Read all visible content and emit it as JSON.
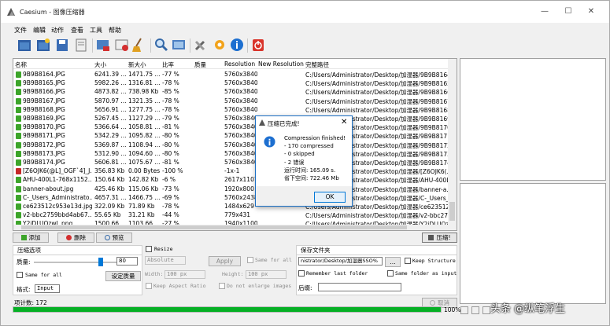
{
  "window": {
    "title": "Caesium - 图像压缩器"
  },
  "menu": [
    "文件",
    "编辑",
    "动作",
    "查看",
    "工具",
    "帮助"
  ],
  "toolbar_icons": [
    "open-folder-icon",
    "add-folder-icon",
    "save-icon",
    "document-icon",
    "remove-image-icon",
    "delete-all-icon",
    "clear-list-icon",
    "search-icon",
    "preview-icon",
    "settings-icon",
    "gear-icon",
    "info-icon",
    "exit-icon"
  ],
  "list": {
    "headers": [
      "名称",
      "大小",
      "新大小",
      "比率",
      "质量",
      "Resolution",
      "New Resolution",
      "完整路径"
    ],
    "rows": [
      {
        "name": "9B9B8164.JPG",
        "size": "6241.39 ...",
        "newsize": "1471.75 ...",
        "ratio": "-77 %",
        "res": "5760x3840",
        "path": "C:/Users/Administrator/Desktop/加湿器/9B9B8164...",
        "status": "ok"
      },
      {
        "name": "9B9B8165.JPG",
        "size": "5982.26 ...",
        "newsize": "1316.81 ...",
        "ratio": "-78 %",
        "res": "5760x3840",
        "path": "C:/Users/Administrator/Desktop/加湿器/9B9B8165...",
        "status": "ok"
      },
      {
        "name": "9B9B8166.JPG",
        "size": "4873.82 ...",
        "newsize": "738.98 Kb",
        "ratio": "-85 %",
        "res": "5760x3840",
        "path": "C:/Users/Administrator/Desktop/加湿器/9B9B8166...",
        "status": "ok"
      },
      {
        "name": "9B9B8167.JPG",
        "size": "5870.97 ...",
        "newsize": "1321.35 ...",
        "ratio": "-78 %",
        "res": "5760x3840",
        "path": "C:/Users/Administrator/Desktop/加湿器/9B9B8167...",
        "status": "ok"
      },
      {
        "name": "9B9B8168.JPG",
        "size": "5656.91 ...",
        "newsize": "1277.75 ...",
        "ratio": "-78 %",
        "res": "5760x3840",
        "path": "C:/Users/Administrator/Desktop/加湿器/9B9B8168...",
        "status": "ok"
      },
      {
        "name": "9B9B8169.JPG",
        "size": "5267.45 ...",
        "newsize": "1127.29 ...",
        "ratio": "-79 %",
        "res": "5760x3840",
        "path": "C:/Users/Administrator/Desktop/加湿器/9B9B8169...",
        "status": "ok"
      },
      {
        "name": "9B9B8170.JPG",
        "size": "5366.64 ...",
        "newsize": "1058.81 ...",
        "ratio": "-81 %",
        "res": "5760x3840",
        "path": "C:/Users/Administrator/Desktop/加湿器/9B9B8170...",
        "status": "ok"
      },
      {
        "name": "9B9B8171.JPG",
        "size": "5342.29 ...",
        "newsize": "1095.82 ...",
        "ratio": "-80 %",
        "res": "5760x3840",
        "path": "C:/Users/Administrator/Desktop/加湿器/9B9B8171...",
        "status": "ok"
      },
      {
        "name": "9B9B8172.JPG",
        "size": "5369.87 ...",
        "newsize": "1108.94 ...",
        "ratio": "-80 %",
        "res": "5760x3840",
        "path": "C:/Users/Administrator/Desktop/加湿器/9B9B8172...",
        "status": "ok"
      },
      {
        "name": "9B9B8173.JPG",
        "size": "5312.90 ...",
        "newsize": "1094.60 ...",
        "ratio": "-80 %",
        "res": "5760x3840",
        "path": "C:/Users/Administrator/Desktop/加湿器/9B9B8173...",
        "status": "ok"
      },
      {
        "name": "9B9B8174.JPG",
        "size": "5606.81 ...",
        "newsize": "1075.67 ...",
        "ratio": "-81 %",
        "res": "5760x3840",
        "path": "C:/Users/Administrator/Desktop/加湿器/9B9B8174...",
        "status": "ok"
      },
      {
        "name": "[Z6OJK6(@L]_OGF`4]_J...",
        "size": "356.83 Kb",
        "newsize": "0.00 Bytes",
        "ratio": "-100 %",
        "res": "-1x-1",
        "path": "C:/Users/Administrator/Desktop/加湿器/[Z6OJK6(...",
        "status": "error"
      },
      {
        "name": "AHU-400L1-768x1152....",
        "size": "150.64 Kb",
        "newsize": "142.82 Kb",
        "ratio": "-6 %",
        "res": "2617x1107",
        "path": "C:/Users/Administrator/Desktop/加湿器/AHU-400L...",
        "status": "ok"
      },
      {
        "name": "banner-about.jpg",
        "size": "425.46 Kb",
        "newsize": "115.06 Kb",
        "ratio": "-73 %",
        "res": "1920x800",
        "path": "C:/Users/Administrator/Desktop/加湿器/banner-a...",
        "status": "ok"
      },
      {
        "name": "C-_Users_Administrato...",
        "size": "4657.31 ...",
        "newsize": "1466.75 ...",
        "ratio": "-69 %",
        "res": "5760x2438",
        "path": "C:/Users/Administrator/Desktop/加湿器/C-_Users_...",
        "status": "ok"
      },
      {
        "name": "ce623512c953e13d.jpg",
        "size": "322.09 Kb",
        "newsize": "71.89 Kb",
        "ratio": "-78 %",
        "res": "1484x629",
        "path": "C:/Users/Administrator/Desktop/加湿器/ce623512...",
        "status": "ok"
      },
      {
        "name": "v2-bbc2759bbd4ab67...",
        "size": "55.65 Kb",
        "newsize": "31.21 Kb",
        "ratio": "-44 %",
        "res": "779x431",
        "path": "C:/Users/Administrator/Desktop/加湿器/v2-bbc27...",
        "status": "ok"
      },
      {
        "name": "Y2jDLUQzwL.png",
        "size": "1500.66 ...",
        "newsize": "1103.66 ...",
        "ratio": "-27 %",
        "res": "1940x1100",
        "path": "C:/Users/Administrator/Desktop/加湿器/Y2jDLUQz...",
        "status": "ok"
      }
    ]
  },
  "actions": {
    "add": "添加",
    "remove": "删除",
    "preview": "预览",
    "compress": "压缩!"
  },
  "compression": {
    "tab": "压缩选项",
    "quality_label": "质量:",
    "quality_value": "80",
    "quality_fraction": 0.8,
    "same_for_all": "Same for all",
    "set_quality": "设定质量",
    "format_label": "格式:",
    "format_value": "Input"
  },
  "resize": {
    "label": "Resize",
    "mode": "Absolute",
    "apply": "Apply",
    "same_for_all": "Same for all",
    "width_label": "Width:",
    "width_value": "100 px",
    "height_label": "Height:",
    "height_value": "100 px",
    "keep_aspect": "Keep Aspect Ratio",
    "no_enlarge": "Do not enlarge images"
  },
  "output": {
    "tab": "保存文件夹",
    "folder": "nistrator/Desktop/加湿器SSO%",
    "browse": "...",
    "keep_structure": "Keep Structure",
    "remember_last": "Remember last folder",
    "same_as_input": "Same folder as input",
    "suffix_label": "后缀:"
  },
  "status": {
    "items_label": "项计数: 172",
    "progress_fraction": 1.0,
    "progress_text": "100%",
    "cancel": "取消"
  },
  "dialog": {
    "title": "压缩已完成!",
    "lines": [
      "Compression finished!",
      "- 170 compressed",
      "- 0 skipped",
      "- 2 错误",
      "运行时间: 165.09 s.",
      "省下空间: 722.46 Mb"
    ],
    "ok": "OK"
  },
  "watermark": "头条 @纵笔浮生",
  "colors": {
    "accent": "#0078d7",
    "progress": "#06b025",
    "ok_icon": "#3da52a",
    "err_icon": "#c62828"
  }
}
